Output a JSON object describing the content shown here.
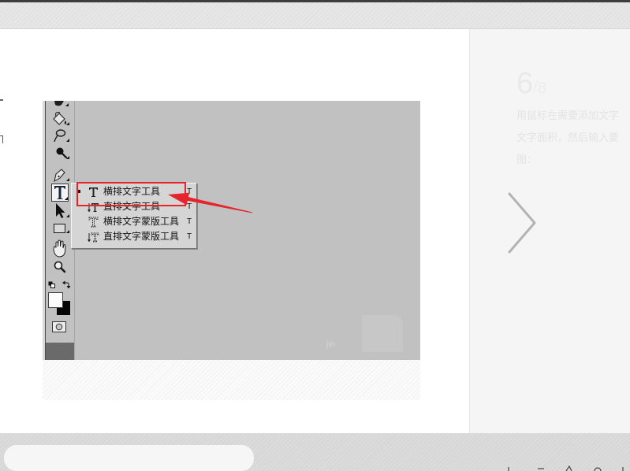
{
  "colors": {
    "accent_red": "#e4252b",
    "canvas_gray": "#c1c1c1",
    "panel_bg": "#f5f5f5",
    "chevron": "#b3b3b3"
  },
  "slide": {
    "current": "6",
    "total": "/8",
    "step_lines": [
      "用鼠标在需要添加文字",
      "文字面积，然后输入要",
      "图："
    ]
  },
  "screenshot": {
    "watermark": "jin",
    "toolbar_icons": [
      "brush-icon",
      "paint-bucket-icon",
      "smudge-icon",
      "burn-icon",
      "pen-icon",
      "type-icon",
      "path-selection-icon",
      "rectangle-icon",
      "hand-icon",
      "zoom-icon",
      "default-colors-icon",
      "swap-colors-icon",
      "color-swatches-icon",
      "quick-mask-icon"
    ],
    "selected_tool": "type-icon",
    "type_menu": {
      "items": [
        {
          "label": "横排文字工具",
          "shortcut": "T",
          "icon": "horizontal-type-icon",
          "selected": true
        },
        {
          "label": "直排文字工具",
          "shortcut": "T",
          "icon": "vertical-type-icon",
          "selected": false
        },
        {
          "label": "横排文字蒙版工具",
          "shortcut": "T",
          "icon": "horizontal-type-mask-icon",
          "selected": false
        },
        {
          "label": "直排文字蒙版工具",
          "shortcut": "T",
          "icon": "vertical-type-mask-icon",
          "selected": false
        }
      ]
    },
    "annotation": {
      "highlighted_index": 0,
      "arrow_icon": "red-arrow-icon"
    }
  },
  "navigation": {
    "next_icon": "chevron-right-icon"
  }
}
